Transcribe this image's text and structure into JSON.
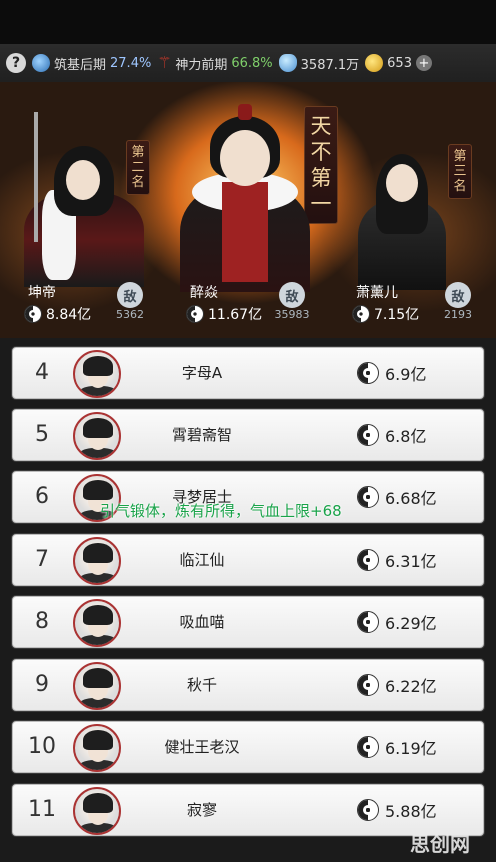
{
  "status_bar": {
    "realm_label": "筑基后期",
    "realm_pct": "27.4%",
    "spirit_label": "神力前期",
    "spirit_pct": "66.8%",
    "stones": "3587.1万",
    "coins": "653",
    "help": "?",
    "plus": "+"
  },
  "podium": {
    "banners": {
      "first": "天不第一",
      "second": "第二名",
      "third": "第三名"
    },
    "first": {
      "name": "醉焱",
      "power": "11.67亿",
      "badge": "敌",
      "badge_num": "35983"
    },
    "second": {
      "name": "坤帝",
      "power": "8.84亿",
      "badge": "敌",
      "badge_num": "5362"
    },
    "third": {
      "name": "萧薰儿",
      "power": "7.15亿",
      "badge": "敌",
      "badge_num": "2193"
    }
  },
  "rankings": [
    {
      "rank": "4",
      "name": "字母A",
      "power": "6.9亿"
    },
    {
      "rank": "5",
      "name": "霄碧斋智",
      "power": "6.8亿"
    },
    {
      "rank": "6",
      "name": "寻梦居士",
      "power": "6.68亿"
    },
    {
      "rank": "7",
      "name": "临江仙",
      "power": "6.31亿"
    },
    {
      "rank": "8",
      "name": "吸血喵",
      "power": "6.29亿"
    },
    {
      "rank": "9",
      "name": "秋千",
      "power": "6.22亿"
    },
    {
      "rank": "10",
      "name": "健壮王老汉",
      "power": "6.19亿"
    },
    {
      "rank": "11",
      "name": "寂寥",
      "power": "5.88亿"
    }
  ],
  "toast": "引气锻体，炼有所得，气血上限+68",
  "watermark": "思创网",
  "colors": {
    "toast_green": "#1aa34a",
    "gold": "#e8c38e"
  }
}
